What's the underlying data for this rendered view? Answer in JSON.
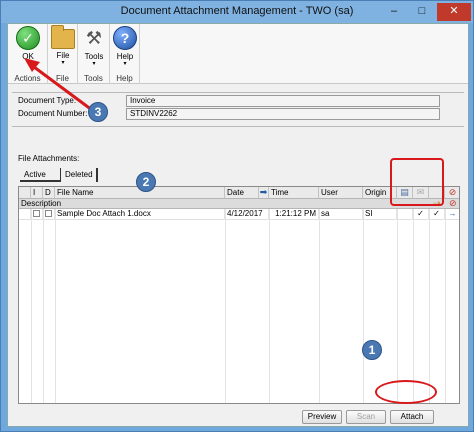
{
  "window": {
    "title": "Document Attachment Management  -  TWO (sa)",
    "minimize": "–",
    "maximize": "□",
    "close": "✕"
  },
  "ribbon": {
    "ok_label": "OK",
    "file_label": "File",
    "tools_label": "Tools",
    "help_label": "Help",
    "arrow": "▾",
    "group_actions": "Actions",
    "group_file": "File",
    "group_tools": "Tools",
    "group_help": "Help",
    "icons": [
      "check-icon",
      "folder-icon",
      "tools-icon",
      "help-icon"
    ]
  },
  "document": {
    "type_label": "Document Type:",
    "type_value": "Invoice",
    "number_label": "Document Number:",
    "number_value": "STDINV2262"
  },
  "attachments": {
    "label": "File Attachments:",
    "tabs": [
      "Active",
      "Deleted"
    ]
  },
  "grid": {
    "columns": [
      "I",
      "D",
      "File Name",
      "Date",
      "Time",
      "User",
      "Origin"
    ],
    "subheader": "Description",
    "rows": [
      {
        "file_name": "Sample Doc Attach 1.docx",
        "date": "4/12/2017",
        "time": "1:21:12 PM",
        "user": "sa",
        "origin": "SI",
        "check1": "✓",
        "check2": "✓",
        "arrow": "→"
      }
    ]
  },
  "buttons": {
    "preview": "Preview",
    "scan": "Scan",
    "attach": "Attach"
  },
  "callouts": {
    "one": "1",
    "two": "2",
    "three": "3"
  },
  "colors": {
    "callout": "#4a78b3",
    "highlight": "#d7191c",
    "title_bar": "#7fb2e0"
  }
}
